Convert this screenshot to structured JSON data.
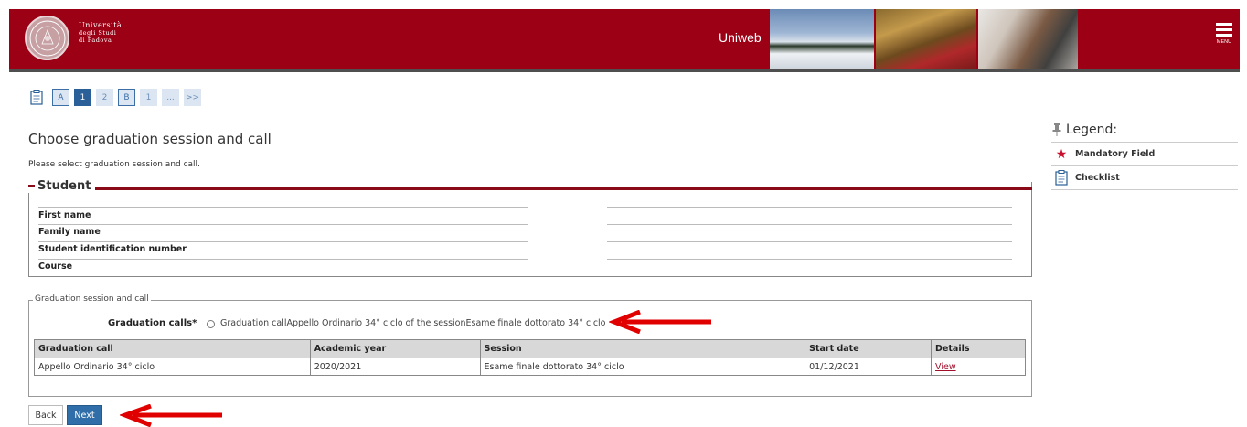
{
  "header": {
    "logo_line1": "Università",
    "logo_line2": "degli Studi",
    "logo_line3": "di Padova",
    "app_name": "Uniweb",
    "menu_label": "MENU"
  },
  "steps": [
    "A",
    "1",
    "2",
    "B",
    "1",
    "...",
    ">>"
  ],
  "page": {
    "title": "Choose graduation session and call",
    "intro": "Please select graduation session and call."
  },
  "student": {
    "legend": "Student",
    "fields": [
      "First name",
      "Family name",
      "Student identification number",
      "Course"
    ]
  },
  "graduation": {
    "legend": "Graduation session and call",
    "calls_label": "Graduation calls*",
    "radio_option": "Graduation callAppello Ordinario 34° ciclo of the sessionEsame finale dottorato 34° ciclo",
    "table": {
      "headers": [
        "Graduation call",
        "Academic year",
        "Session",
        "Start date",
        "Details"
      ],
      "rows": [
        [
          "Appello Ordinario 34° ciclo",
          "2020/2021",
          "Esame finale dottorato 34° ciclo",
          "01/12/2021",
          "View"
        ]
      ]
    }
  },
  "buttons": {
    "back": "Back",
    "next": "Next"
  },
  "legend": {
    "title": "Legend:",
    "items": [
      "Mandatory Field",
      "Checklist"
    ]
  },
  "colors": {
    "brand": "#9b0014",
    "accent": "#2f6ea8",
    "arrow": "#e00000"
  }
}
